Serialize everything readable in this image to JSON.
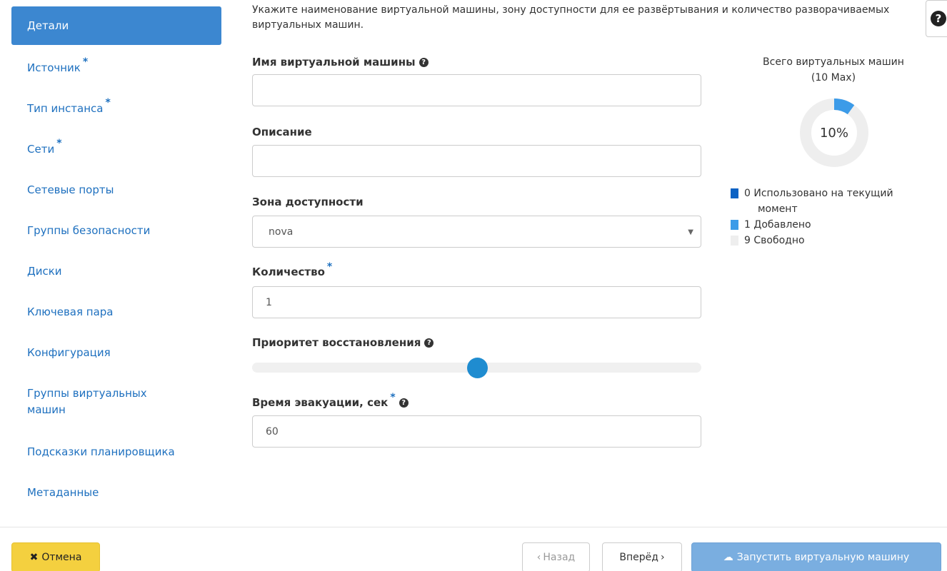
{
  "sidebar": {
    "items": [
      {
        "label": "Детали",
        "required": false,
        "active": true
      },
      {
        "label": "Источник",
        "required": true
      },
      {
        "label": "Тип инстанса",
        "required": true
      },
      {
        "label": "Сети",
        "required": true
      },
      {
        "label": "Сетевые порты",
        "required": false
      },
      {
        "label": "Группы безопасности",
        "required": false
      },
      {
        "label": "Диски",
        "required": false
      },
      {
        "label": "Ключевая пара",
        "required": false
      },
      {
        "label": "Конфигурация",
        "required": false
      },
      {
        "label": "Группы виртуальных машин",
        "required": false
      },
      {
        "label": "Подсказки планировщика",
        "required": false
      },
      {
        "label": "Метаданные",
        "required": false
      }
    ],
    "required_mark": "*"
  },
  "form": {
    "intro": "Укажите наименование виртуальной машины, зону доступности для ее развёртывания и количество разворачиваемых виртуальных машин.",
    "vm_name": {
      "label": "Имя виртуальной машины",
      "value": ""
    },
    "description": {
      "label": "Описание",
      "value": ""
    },
    "availability_zone": {
      "label": "Зона доступности",
      "value": "nova"
    },
    "count": {
      "label": "Количество",
      "value": "1"
    },
    "recovery_priority": {
      "label": "Приоритет восстановления",
      "level": 0.5
    },
    "evacuation_time": {
      "label": "Время эвакуации, сек",
      "value": "60"
    }
  },
  "usage": {
    "title": "Всего виртуальных машин",
    "subtitle": "(10 Max)",
    "percent_label": "10%",
    "max": 10,
    "used": {
      "count": "0",
      "label": "Использовано на текущий",
      "label2": "момент",
      "color": "#0b62c4"
    },
    "added": {
      "count": "1",
      "label": "Добавлено",
      "color": "#3c9be8"
    },
    "free": {
      "count": "9",
      "label": "Свободно",
      "color": "#eeeeee"
    }
  },
  "footer": {
    "cancel": "Отмена",
    "back": "Назад",
    "next": "Вперёд",
    "launch": "Запустить виртуальную машину"
  },
  "colors": {
    "accent": "#3c87d0",
    "link": "#1e70bf",
    "cancel": "#f4d03f",
    "launch": "#7aaee0"
  }
}
